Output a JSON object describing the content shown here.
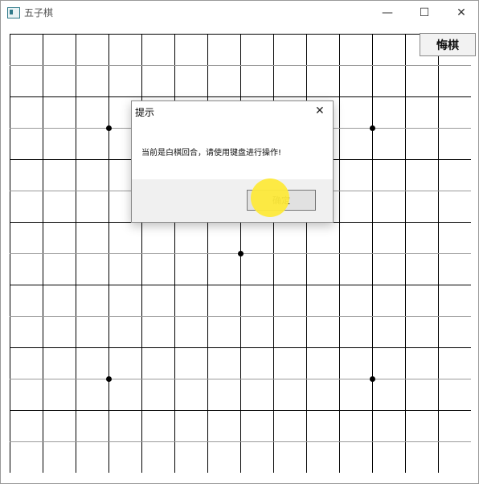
{
  "window": {
    "title": "五子棋"
  },
  "controls": {
    "minimize": "—",
    "maximize": "☐",
    "close": "✕"
  },
  "board": {
    "columns": 15,
    "rows": 15,
    "star_points": [
      "D4",
      "L4",
      "H8",
      "D12",
      "L12"
    ]
  },
  "toolbar": {
    "undo_label": "悔棋"
  },
  "dialog": {
    "title": "提示",
    "close": "✕",
    "message": "当前是白棋回合，请使用键盘进行操作!",
    "ok_label": "确定"
  }
}
